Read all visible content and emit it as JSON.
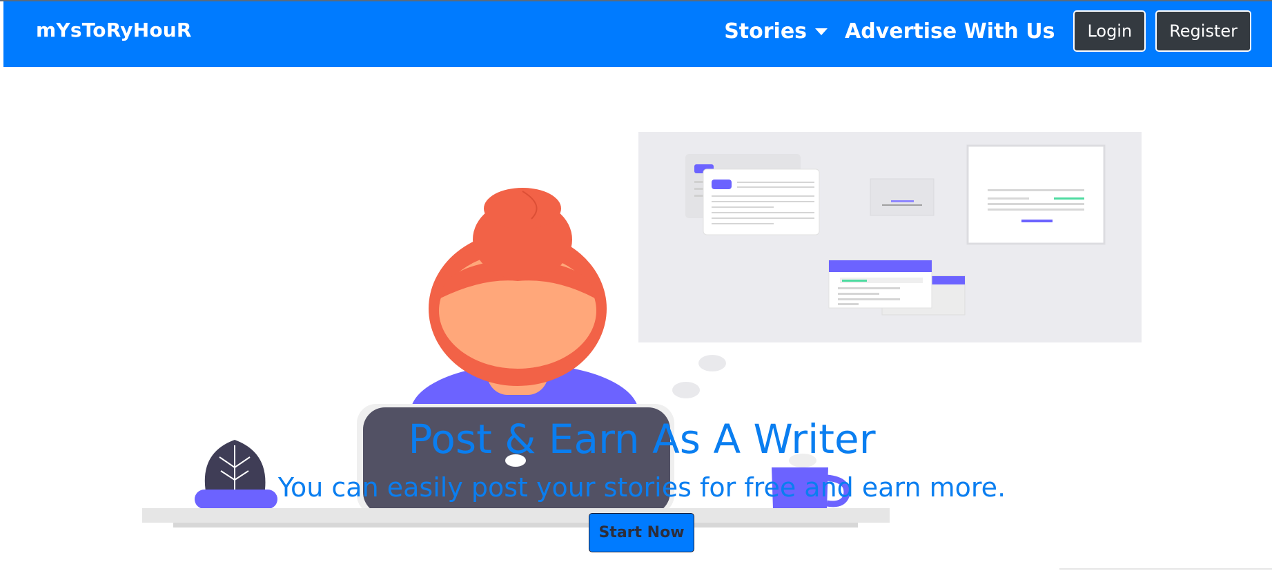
{
  "navbar": {
    "brand": "mYsToRyHouR",
    "stories_label": "Stories",
    "advertise_label": "Advertise With Us",
    "login_label": "Login",
    "register_label": "Register"
  },
  "hero": {
    "headline": "Post & Earn As A Writer",
    "subline": "You can easily post your stories for free and earn more.",
    "cta_label": "Start Now"
  },
  "colors": {
    "navbar_bg": "#007bff",
    "button_dark": "#343a40",
    "hero_text": "#0a7ef0",
    "accent_purple": "#6c63ff",
    "hair": "#f26247"
  },
  "icons": {
    "stories_dropdown": "caret-down-icon"
  }
}
